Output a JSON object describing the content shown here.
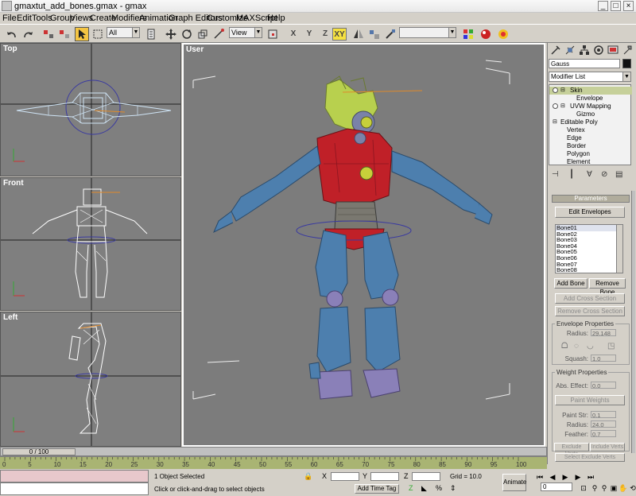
{
  "window": {
    "title": "gmaxtut_add_bones.gmax - gmax",
    "minimize": "_",
    "maximize": "□",
    "close": "×"
  },
  "menu": [
    "File",
    "Edit",
    "Tools",
    "Group",
    "Views",
    "Create",
    "Modifiers",
    "Animation",
    "Graph Editors",
    "Customize",
    "MAXScript",
    "Help"
  ],
  "toolbar": {
    "selection_filter": "All",
    "ref_coord": "View",
    "axis_x": "X",
    "axis_y": "Y",
    "axis_z": "Z",
    "axis_xy": "XY",
    "named_selection": ""
  },
  "viewports": {
    "top": "Top",
    "front": "Front",
    "left": "Left",
    "user": "User"
  },
  "command_panel": {
    "object_name": "Gauss",
    "modifier_list": "Modifier List",
    "stack": [
      {
        "label": "Skin",
        "indent": 0,
        "selected": true
      },
      {
        "label": "Envelope",
        "indent": 1,
        "selected": false
      },
      {
        "label": "UVW Mapping",
        "indent": 0,
        "selected": false
      },
      {
        "label": "Gizmo",
        "indent": 1,
        "selected": false
      },
      {
        "label": "Editable Poly",
        "indent": 0,
        "selected": false
      },
      {
        "label": "Vertex",
        "indent": 1,
        "selected": false
      },
      {
        "label": "Edge",
        "indent": 1,
        "selected": false
      },
      {
        "label": "Border",
        "indent": 1,
        "selected": false
      },
      {
        "label": "Polygon",
        "indent": 1,
        "selected": false
      },
      {
        "label": "Element",
        "indent": 1,
        "selected": false
      }
    ],
    "parameters_title": "Parameters",
    "edit_envelopes": "Edit Envelopes",
    "bones": [
      "Bone01",
      "Bone02",
      "Bone03",
      "Bone04",
      "Bone05",
      "Bone06",
      "Bone07",
      "Bone08"
    ],
    "add_bone": "Add Bone",
    "remove_bone": "Remove Bone",
    "add_cross_section": "Add Cross Section",
    "remove_cross_section": "Remove Cross Section",
    "envelope_properties": "Envelope Properties",
    "radius_label": "Radius:",
    "radius_value": "29.148",
    "squash_label": "Squash:",
    "squash_value": "1.0",
    "weight_properties": "Weight Properties",
    "abs_effect_label": "Abs. Effect:",
    "abs_effect_value": "0.0",
    "paint_weights": "Paint Weights",
    "paint_str_label": "Paint Str:",
    "paint_str_value": "0.1",
    "radius2_label": "Radius:",
    "radius2_value": "24.0",
    "feather_label": "Feather:",
    "feather_value": "0.7",
    "exclude_verts": "Exclude Verts",
    "include_verts": "Include Verts",
    "select_exclude_verts": "Select Exclude Verts"
  },
  "timeline": {
    "slider": "0 / 100",
    "ticks": [
      "0",
      "5",
      "10",
      "15",
      "20",
      "25",
      "30",
      "35",
      "40",
      "45",
      "50",
      "55",
      "60",
      "65",
      "70",
      "75",
      "80",
      "85",
      "90",
      "95",
      "100"
    ]
  },
  "status": {
    "selected": "1 Object Selected",
    "prompt": "Click or click-and-drag to select objects",
    "grid": "Grid = 10.0",
    "add_time_tag": "Add Time Tag",
    "animate": "Animate",
    "frame": "0"
  }
}
